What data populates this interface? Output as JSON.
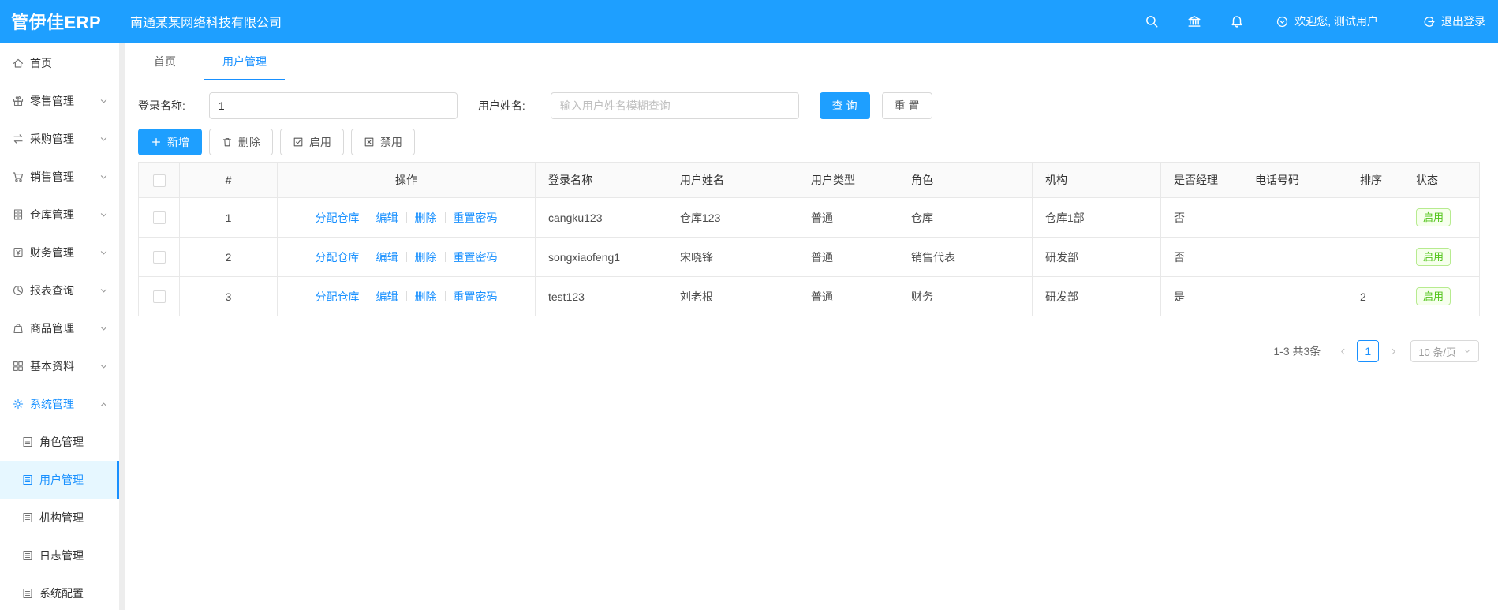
{
  "header": {
    "logo": "管伊佳ERP",
    "company": "南通某某网络科技有限公司",
    "welcome": "欢迎您, 测试用户",
    "logout": "退出登录",
    "bar_color": "#1e9fff"
  },
  "sidebar": {
    "items": [
      {
        "label": "首页",
        "icon": "home"
      },
      {
        "label": "零售管理",
        "icon": "gift"
      },
      {
        "label": "采购管理",
        "icon": "swap"
      },
      {
        "label": "销售管理",
        "icon": "cart"
      },
      {
        "label": "仓库管理",
        "icon": "cabinet"
      },
      {
        "label": "财务管理",
        "icon": "finance"
      },
      {
        "label": "报表查询",
        "icon": "pie-chart"
      },
      {
        "label": "商品管理",
        "icon": "bag"
      },
      {
        "label": "基本资料",
        "icon": "grid"
      },
      {
        "label": "系统管理",
        "icon": "gear"
      }
    ],
    "system_children": [
      {
        "label": "角色管理"
      },
      {
        "label": "用户管理"
      },
      {
        "label": "机构管理"
      },
      {
        "label": "日志管理"
      },
      {
        "label": "系统配置"
      }
    ]
  },
  "tabs": {
    "home": "首页",
    "current": "用户管理"
  },
  "filter": {
    "login_label": "登录名称:",
    "login_value": "1",
    "name_label": "用户姓名:",
    "name_placeholder": "输入用户姓名模糊查询",
    "search_button": "查 询",
    "reset_button": "重 置"
  },
  "toolbar": {
    "add": "新增",
    "delete": "删除",
    "enable": "启用",
    "disable": "禁用"
  },
  "table": {
    "columns": [
      "#",
      "操作",
      "登录名称",
      "用户姓名",
      "用户类型",
      "角色",
      "机构",
      "是否经理",
      "电话号码",
      "排序",
      "状态"
    ],
    "action_links": [
      "分配仓库",
      "编辑",
      "删除",
      "重置密码"
    ],
    "rows": [
      {
        "index": "1",
        "login": "cangku123",
        "name": "仓库123",
        "type": "普通",
        "role": "仓库",
        "org": "仓库1部",
        "manager": "否",
        "phone": "",
        "sort": "",
        "status": "启用"
      },
      {
        "index": "2",
        "login": "songxiaofeng1",
        "name": "宋晓锋",
        "type": "普通",
        "role": "销售代表",
        "org": "研发部",
        "manager": "否",
        "phone": "",
        "sort": "",
        "status": "启用"
      },
      {
        "index": "3",
        "login": "test123",
        "name": "刘老根",
        "type": "普通",
        "role": "财务",
        "org": "研发部",
        "manager": "是",
        "phone": "",
        "sort": "2",
        "status": "启用"
      }
    ],
    "status_color": "#52c41a"
  },
  "pagination": {
    "total": "1-3 共3条",
    "current_page": "1",
    "page_size": "10 条/页"
  }
}
